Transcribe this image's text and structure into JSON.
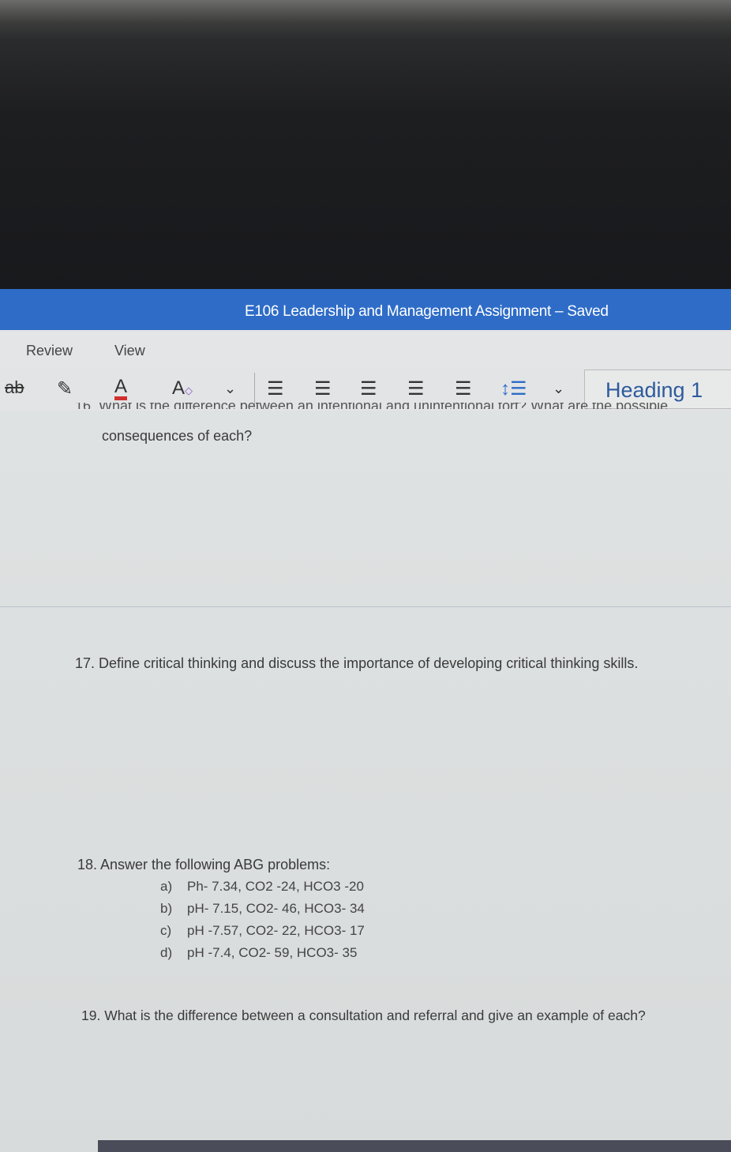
{
  "window": {
    "title": "E106 Leadership and Management Assignment – Saved"
  },
  "menu": [
    "Review",
    "View"
  ],
  "toolbar": {
    "icons": [
      "strikethrough-icon",
      "highlighter-icon",
      "font-color-icon",
      "clear-formatting-icon",
      "chevron-down-icon",
      "bullet-list-icon",
      "numbered-list-icon",
      "decrease-indent-icon",
      "increase-indent-icon",
      "align-icon",
      "line-spacing-icon",
      "chevron-down-icon"
    ],
    "font_color": "#d03030",
    "style": "Heading 1"
  },
  "document": {
    "q16_cut": "16. What is the difference between an intentional and unintentional tort? What are the possible",
    "q16_cont": "consequences of each?",
    "q17": "17. Define critical thinking and discuss the importance of developing critical thinking skills.",
    "q18": "18. Answer the following ABG problems:",
    "q18_items": [
      {
        "label": "a)",
        "text": "Ph- 7.34, CO2 -24, HCO3 -20"
      },
      {
        "label": "b)",
        "text": "pH- 7.15, CO2- 46, HCO3- 34"
      },
      {
        "label": "c)",
        "text": "pH -7.57, CO2- 22, HCO3- 17"
      },
      {
        "label": "d)",
        "text": "pH -7.4, CO2- 59, HCO3- 35"
      }
    ],
    "q19": "19. What is the difference between a consultation and referral and give an example of each?"
  },
  "colors": {
    "titlebar": "#2e6cc7",
    "style_text": "#2e5a9c"
  }
}
